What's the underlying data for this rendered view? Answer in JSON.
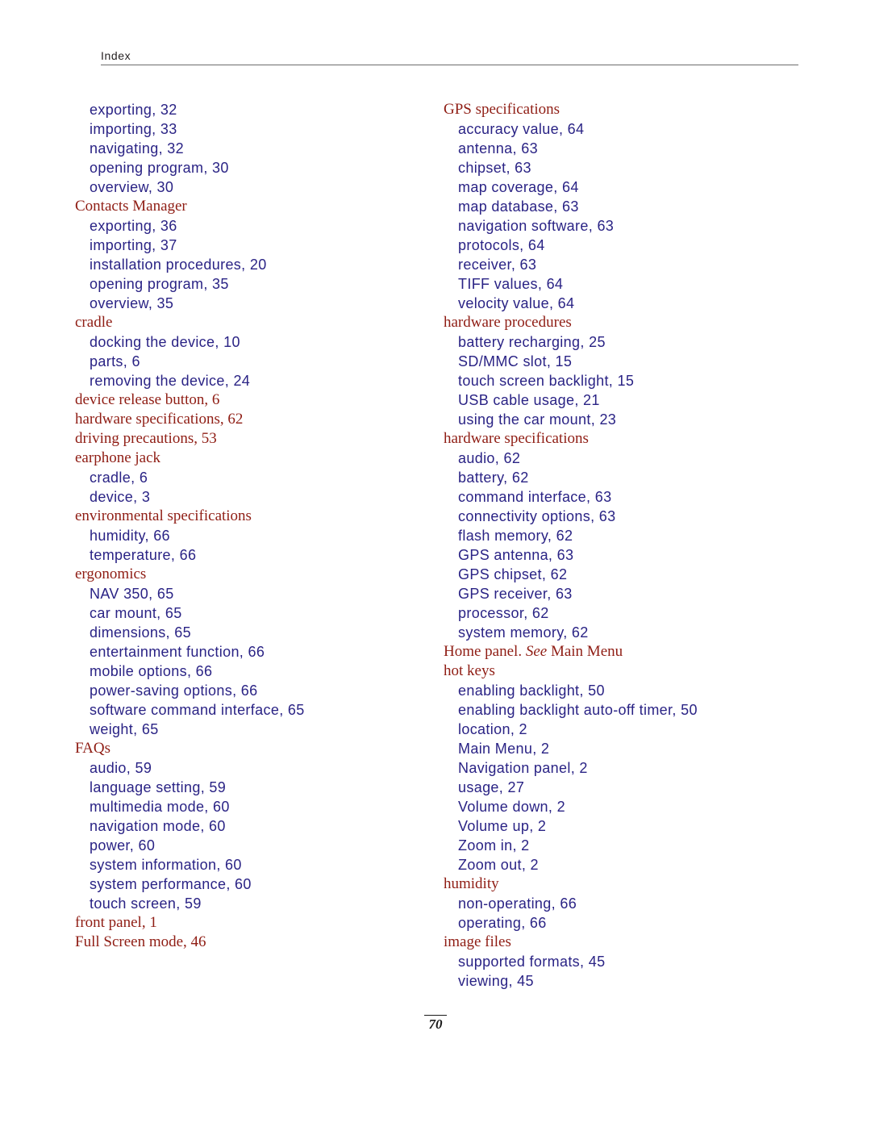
{
  "header": {
    "title": "Index"
  },
  "footer": {
    "page_number": "70"
  },
  "colors": {
    "main_entry": "#8f1d14",
    "sub_entry": "#2a2385",
    "header_text": "#231f20",
    "rule": "#6d6d6d",
    "page_background": "#ffffff"
  },
  "columns": [
    {
      "name": "left-column",
      "entries": [
        {
          "level": 2,
          "text": "exporting, 32"
        },
        {
          "level": 2,
          "text": "importing, 33"
        },
        {
          "level": 2,
          "text": "navigating, 32"
        },
        {
          "level": 2,
          "text": "opening program, 30"
        },
        {
          "level": 2,
          "text": "overview, 30"
        },
        {
          "level": 1,
          "text": "Contacts Manager"
        },
        {
          "level": 2,
          "text": "exporting, 36"
        },
        {
          "level": 2,
          "text": "importing, 37"
        },
        {
          "level": 2,
          "text": "installation procedures, 20"
        },
        {
          "level": 2,
          "text": "opening program, 35"
        },
        {
          "level": 2,
          "text": "overview, 35"
        },
        {
          "level": 1,
          "text": "cradle"
        },
        {
          "level": 2,
          "text": "docking the device, 10"
        },
        {
          "level": 2,
          "text": "parts, 6"
        },
        {
          "level": 2,
          "text": "removing the device, 24"
        },
        {
          "level": 1,
          "text": "device release button, 6"
        },
        {
          "level": 1,
          "text": "hardware specifications, 62"
        },
        {
          "level": 1,
          "text": "driving precautions, 53"
        },
        {
          "level": 1,
          "text": "earphone jack"
        },
        {
          "level": 2,
          "text": "cradle, 6"
        },
        {
          "level": 2,
          "text": "device, 3"
        },
        {
          "level": 1,
          "text": "environmental specifications"
        },
        {
          "level": 2,
          "text": "humidity, 66"
        },
        {
          "level": 2,
          "text": "temperature, 66"
        },
        {
          "level": 1,
          "text": "ergonomics"
        },
        {
          "level": 2,
          "text": "NAV 350, 65"
        },
        {
          "level": 2,
          "text": "car mount, 65"
        },
        {
          "level": 2,
          "text": "dimensions, 65"
        },
        {
          "level": 2,
          "text": "entertainment function, 66"
        },
        {
          "level": 2,
          "text": "mobile options, 66"
        },
        {
          "level": 2,
          "text": "power-saving options, 66"
        },
        {
          "level": 2,
          "text": "software command interface, 65"
        },
        {
          "level": 2,
          "text": "weight, 65"
        },
        {
          "level": 1,
          "text": "FAQs"
        },
        {
          "level": 2,
          "text": "audio, 59"
        },
        {
          "level": 2,
          "text": "language setting, 59"
        },
        {
          "level": 2,
          "text": "multimedia mode, 60"
        },
        {
          "level": 2,
          "text": "navigation mode, 60"
        },
        {
          "level": 2,
          "text": "power, 60"
        },
        {
          "level": 2,
          "text": "system information, 60"
        },
        {
          "level": 2,
          "text": "system performance, 60"
        },
        {
          "level": 2,
          "text": "touch screen, 59"
        },
        {
          "level": 1,
          "text": "front panel, 1"
        },
        {
          "level": 1,
          "text": "Full Screen mode, 46"
        }
      ]
    },
    {
      "name": "right-column",
      "entries": [
        {
          "level": 1,
          "text": "GPS specifications"
        },
        {
          "level": 2,
          "text": "accuracy value, 64"
        },
        {
          "level": 2,
          "text": "antenna, 63"
        },
        {
          "level": 2,
          "text": "chipset, 63"
        },
        {
          "level": 2,
          "text": "map coverage, 64"
        },
        {
          "level": 2,
          "text": "map database, 63"
        },
        {
          "level": 2,
          "text": "navigation software, 63"
        },
        {
          "level": 2,
          "text": "protocols, 64"
        },
        {
          "level": 2,
          "text": "receiver, 63"
        },
        {
          "level": 2,
          "text": "TIFF values, 64"
        },
        {
          "level": 2,
          "text": "velocity value, 64"
        },
        {
          "level": 1,
          "text": "hardware procedures"
        },
        {
          "level": 2,
          "text": "battery recharging, 25"
        },
        {
          "level": 2,
          "text": "SD/MMC slot, 15"
        },
        {
          "level": 2,
          "text": "touch screen backlight, 15"
        },
        {
          "level": 2,
          "text": "USB cable usage, 21"
        },
        {
          "level": 2,
          "text": "using the car mount, 23"
        },
        {
          "level": 1,
          "text": "hardware specifications"
        },
        {
          "level": 2,
          "text": "audio, 62"
        },
        {
          "level": 2,
          "text": "battery, 62"
        },
        {
          "level": 2,
          "text": "command interface, 63"
        },
        {
          "level": 2,
          "text": "connectivity options, 63"
        },
        {
          "level": 2,
          "text": "flash memory, 62"
        },
        {
          "level": 2,
          "text": "GPS antenna, 63"
        },
        {
          "level": 2,
          "text": "GPS chipset, 62"
        },
        {
          "level": 2,
          "text": "GPS receiver, 63"
        },
        {
          "level": 2,
          "text": "processor, 62"
        },
        {
          "level": 2,
          "text": "system memory, 62"
        },
        {
          "level": 1,
          "text": "Home panel. ",
          "see_ref": "See",
          "text_after": " Main Menu"
        },
        {
          "level": 1,
          "text": "hot keys"
        },
        {
          "level": 2,
          "text": "enabling backlight, 50"
        },
        {
          "level": 2,
          "text": "enabling backlight auto-off timer, 50"
        },
        {
          "level": 2,
          "text": "location, 2"
        },
        {
          "level": 2,
          "text": "Main Menu, 2"
        },
        {
          "level": 2,
          "text": "Navigation panel, 2"
        },
        {
          "level": 2,
          "text": "usage, 27"
        },
        {
          "level": 2,
          "text": "Volume down, 2"
        },
        {
          "level": 2,
          "text": "Volume up, 2"
        },
        {
          "level": 2,
          "text": "Zoom in, 2"
        },
        {
          "level": 2,
          "text": "Zoom out, 2"
        },
        {
          "level": 1,
          "text": "humidity"
        },
        {
          "level": 2,
          "text": "non-operating, 66"
        },
        {
          "level": 2,
          "text": "operating, 66"
        },
        {
          "level": 1,
          "text": "image files"
        },
        {
          "level": 2,
          "text": "supported formats, 45"
        },
        {
          "level": 2,
          "text": "viewing, 45"
        }
      ]
    }
  ]
}
